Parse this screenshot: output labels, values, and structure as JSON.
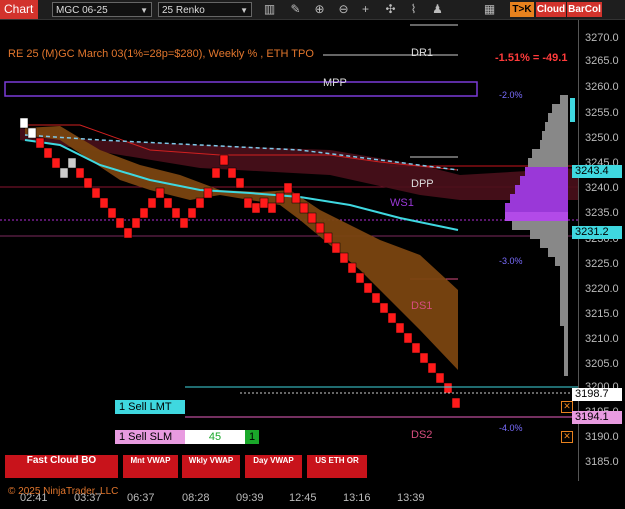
{
  "toolbar": {
    "chart_tab": "Chart",
    "instrument": "MGC 06-25",
    "bar_type": "25 Renko",
    "tok_label": "T>K",
    "cloud_label": "Cloud",
    "barcol_label": "BarCol",
    "icons": [
      "bar-style-icon",
      "draw-icon",
      "zoom-in-icon",
      "zoom-out-icon",
      "crosshair-icon",
      "global-cross-icon",
      "indicator-icon",
      "strategy-icon",
      "properties-icon"
    ]
  },
  "chart": {
    "title": "RE 25 (M)GC March 03(1%=28p=$280), Weekly % , ETH TPO",
    "pnl": "-1.51% = -49.1",
    "levels": {
      "dr1": "DR1",
      "mpp": "MPP",
      "dpp": "DPP",
      "ws1": "WS1",
      "ds1": "DS1",
      "ds2": "DS2"
    },
    "percent_labels": {
      "p_minus2": "-2.0%",
      "p_minus3": "-3.0%",
      "p_minus4": "-4.0%"
    },
    "y_ticks": [
      "3270.0",
      "3265.0",
      "3260.0",
      "3255.0",
      "3250.0",
      "3245.0",
      "3240.0",
      "3235.0",
      "3230.0",
      "3225.0",
      "3220.0",
      "3215.0",
      "3210.0",
      "3205.0",
      "3200.0",
      "3195.0",
      "3190.0",
      "3185.0"
    ],
    "x_ticks": [
      "02:41",
      "03:37",
      "06:37",
      "08:28",
      "09:39",
      "12:45",
      "13:16",
      "13:39"
    ],
    "price_tags": {
      "tag1": "3243.4",
      "tag2": "3231.2",
      "tag3": "3198.7",
      "tag4": "3194.1"
    },
    "orders": {
      "sell_lmt": "1 Sell LMT",
      "sell_slm": "1 Sell SLM",
      "qty": "45",
      "qty_box": "1"
    },
    "colors": {
      "bull": "#ff1a1a",
      "cloud": "#8a4b12",
      "cyan": "#3fd8e0",
      "purple": "#9a38d8",
      "ws": "#8a1530"
    }
  },
  "bottom_buttons": [
    "Fast Cloud BO",
    "Mnt VWAP",
    "Wkly VWAP",
    "Day VWAP",
    "US ETH OR"
  ],
  "copyright": "© 2025 NinjaTrader, LLC"
}
